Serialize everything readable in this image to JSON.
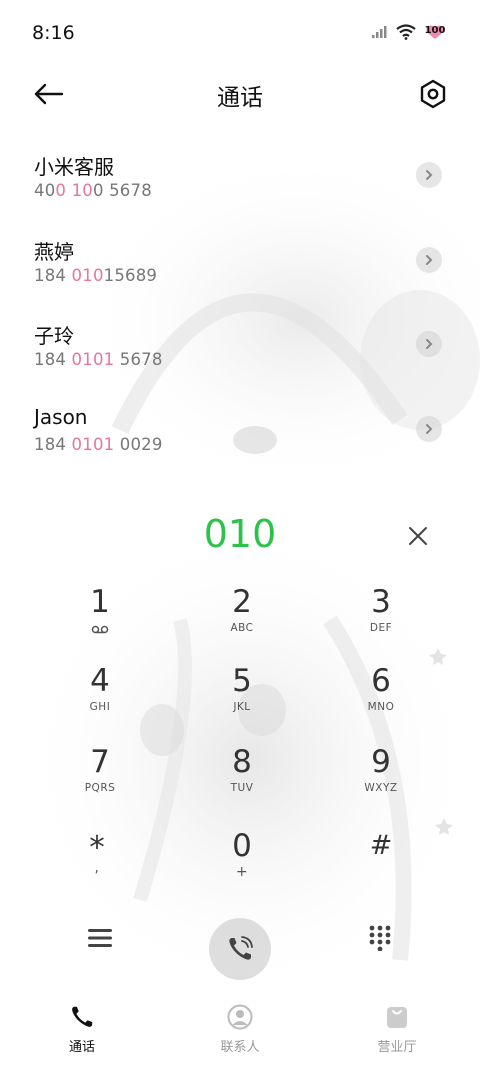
{
  "status_bar": {
    "time": "8:16",
    "battery": "100"
  },
  "header": {
    "title": "通话"
  },
  "contacts": [
    {
      "name": "小米客服",
      "num_parts": [
        "40",
        "0",
        " ",
        "10",
        "0 5678"
      ]
    },
    {
      "name": "燕婷",
      "num_parts": [
        "184 ",
        "010",
        "",
        "",
        "15689"
      ]
    },
    {
      "name": "子玲",
      "num_parts": [
        "184 ",
        "010",
        "",
        "1",
        " 5678"
      ]
    },
    {
      "name": "Jason",
      "num_parts": [
        "184 ",
        "010",
        "",
        "1",
        " 0029"
      ]
    }
  ],
  "dialer": {
    "number": "010",
    "keys": [
      {
        "digit": "1",
        "letters": ""
      },
      {
        "digit": "2",
        "letters": "ABC"
      },
      {
        "digit": "3",
        "letters": "DEF"
      },
      {
        "digit": "4",
        "letters": "GHI"
      },
      {
        "digit": "5",
        "letters": "JKL"
      },
      {
        "digit": "6",
        "letters": "MNO"
      },
      {
        "digit": "7",
        "letters": "PQRS"
      },
      {
        "digit": "8",
        "letters": "TUV"
      },
      {
        "digit": "9",
        "letters": "WXYZ"
      },
      {
        "digit": "*",
        "letters": ","
      },
      {
        "digit": "0",
        "letters": "+"
      },
      {
        "digit": "#",
        "letters": ""
      }
    ]
  },
  "bottom_nav": [
    {
      "label": "通话",
      "active": true
    },
    {
      "label": "联系人",
      "active": false
    },
    {
      "label": "营业厅",
      "active": false
    }
  ],
  "colors": {
    "accent_green": "#2dc24a",
    "highlight_pink": "#e37899"
  },
  "icons": {
    "voicemail": "voicemail-icon",
    "back": "arrow-left-icon",
    "settings": "hexagon-gear-icon",
    "clear": "close-icon",
    "call": "phone-icon",
    "menu": "menu-icon",
    "grid": "dialpad-grid-icon"
  }
}
